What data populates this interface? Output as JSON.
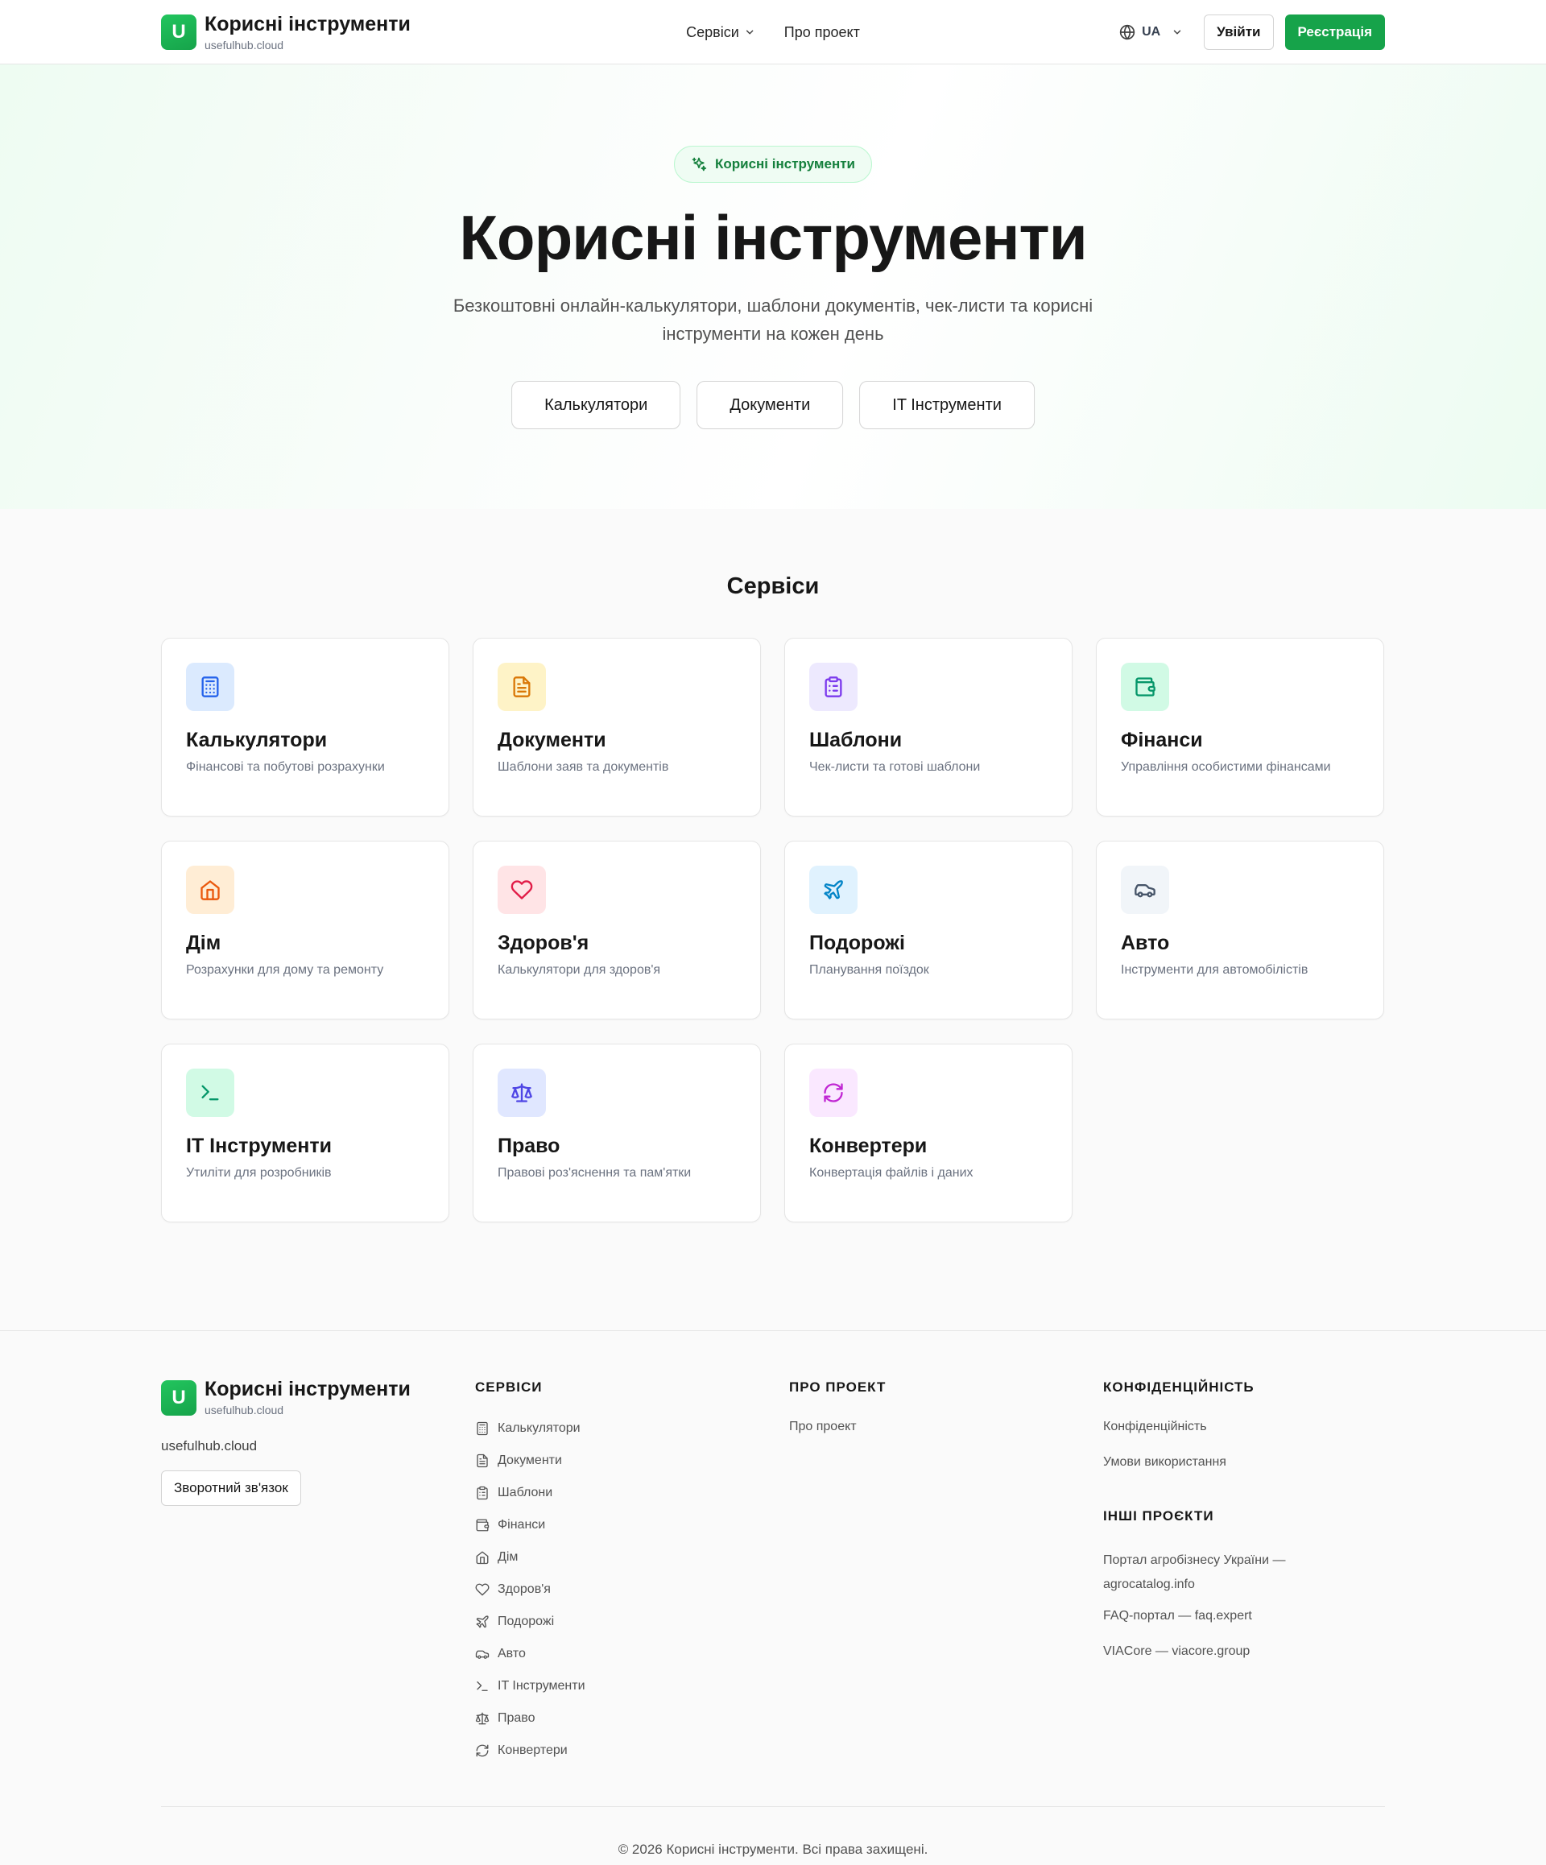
{
  "header": {
    "logo_letter": "U",
    "title": "Корисні інструменти",
    "subtitle": "usefulhub.cloud",
    "nav": [
      {
        "label": "Сервіси"
      },
      {
        "label": "Про проект"
      }
    ],
    "language": "UA",
    "login_label": "Увійти",
    "register_label": "Реєстрація"
  },
  "hero": {
    "badge": "Корисні інструменти",
    "title": "Корисні інструменти",
    "description": "Безкоштовні онлайн-калькулятори, шаблони документів, чек-листи та корисні інструменти на кожен день",
    "buttons": [
      "Калькулятори",
      "Документи",
      "IT Інструменти"
    ]
  },
  "services": {
    "heading": "Сервіси",
    "items": [
      {
        "title": "Калькулятори",
        "desc": "Фінансові та побутові розрахунки",
        "icon": "calculator-icon",
        "bg": "#dbeafe",
        "color": "#2563eb"
      },
      {
        "title": "Документи",
        "desc": "Шаблони заяв та документів",
        "icon": "document-icon",
        "bg": "#fef3c7",
        "color": "#d97706"
      },
      {
        "title": "Шаблони",
        "desc": "Чек-листи та готові шаблони",
        "icon": "clipboard-icon",
        "bg": "#ede9fe",
        "color": "#7c3aed"
      },
      {
        "title": "Фінанси",
        "desc": "Управління особистими фінансами",
        "icon": "wallet-icon",
        "bg": "#d1fae5",
        "color": "#059669"
      },
      {
        "title": "Дім",
        "desc": "Розрахунки для дому та ремонту",
        "icon": "home-icon",
        "bg": "#ffedd5",
        "color": "#ea580c"
      },
      {
        "title": "Здоров'я",
        "desc": "Калькулятори для здоров'я",
        "icon": "heart-icon",
        "bg": "#ffe4e6",
        "color": "#e11d48"
      },
      {
        "title": "Подорожі",
        "desc": "Планування поїздок",
        "icon": "plane-icon",
        "bg": "#e0f2fe",
        "color": "#0284c7"
      },
      {
        "title": "Авто",
        "desc": "Інструменти для автомобілістів",
        "icon": "car-icon",
        "bg": "#f1f5f9",
        "color": "#475569"
      },
      {
        "title": "IT Інструменти",
        "desc": "Утиліти для розробників",
        "icon": "terminal-icon",
        "bg": "#d1fae5",
        "color": "#059669"
      },
      {
        "title": "Право",
        "desc": "Правові роз'яснення та пам'ятки",
        "icon": "scale-icon",
        "bg": "#e0e7ff",
        "color": "#4f46e5"
      },
      {
        "title": "Конвертери",
        "desc": "Конвертація файлів і даних",
        "icon": "refresh-icon",
        "bg": "#fae8ff",
        "color": "#c026d3"
      }
    ]
  },
  "footer": {
    "title": "Корисні інструменти",
    "subtitle": "usefulhub.cloud",
    "site": "usefulhub.cloud",
    "contact_label": "Зворотний зв'язок",
    "services_heading": "СЕРВІСИ",
    "services": [
      {
        "label": "Калькулятори",
        "icon": "calculator-icon"
      },
      {
        "label": "Документи",
        "icon": "document-icon"
      },
      {
        "label": "Шаблони",
        "icon": "clipboard-icon"
      },
      {
        "label": "Фінанси",
        "icon": "wallet-icon"
      },
      {
        "label": "Дім",
        "icon": "home-icon"
      },
      {
        "label": "Здоров'я",
        "icon": "heart-icon"
      },
      {
        "label": "Подорожі",
        "icon": "plane-icon"
      },
      {
        "label": "Авто",
        "icon": "car-icon"
      },
      {
        "label": "IT Інструменти",
        "icon": "terminal-icon"
      },
      {
        "label": "Право",
        "icon": "scale-icon"
      },
      {
        "label": "Конвертери",
        "icon": "refresh-icon"
      }
    ],
    "about_heading": "ПРО ПРОЕКТ",
    "about_links": [
      "Про проект"
    ],
    "privacy_heading": "КОНФІДЕНЦІЙНІСТЬ",
    "privacy_links": [
      "Конфіденційність",
      "Умови використання"
    ],
    "other_heading": "ІНШІ ПРОЄКТИ",
    "other_links": [
      "Портал агробізнесу України — agrocatalog.info",
      "FAQ-портал — faq.expert",
      "VIACore — viacore.group"
    ],
    "copyright": "© 2026 Корисні інструменти. Всі права захищені."
  },
  "colors": {
    "accent": "#16a34a",
    "text": "#171717",
    "muted": "#6b7280"
  }
}
